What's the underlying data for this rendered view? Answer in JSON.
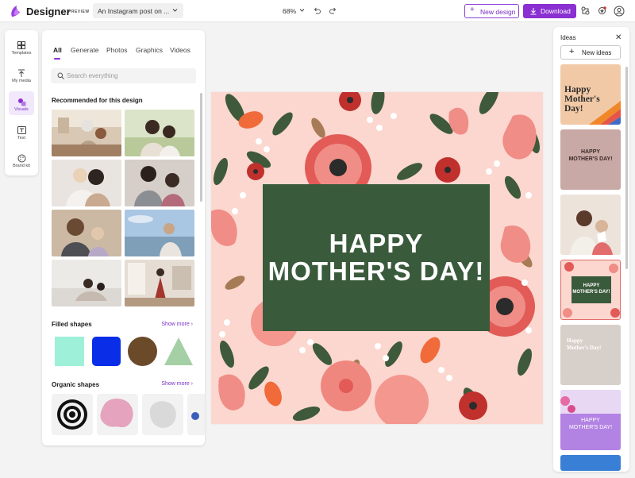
{
  "app": {
    "brand": "Designer",
    "preview_tag": "PREVIEW",
    "doc_title": "An Instagram post on ...",
    "zoom": "68%"
  },
  "toolbar": {
    "new_design": "New design",
    "download": "Download"
  },
  "rail": [
    {
      "label": "Templates",
      "icon": "templates-icon"
    },
    {
      "label": "My media",
      "icon": "upload-icon"
    },
    {
      "label": "Visuals",
      "icon": "visuals-icon",
      "active": true
    },
    {
      "label": "Text",
      "icon": "text-icon"
    },
    {
      "label": "Brand kit",
      "icon": "brand-kit-icon"
    }
  ],
  "panel": {
    "tabs": [
      "All",
      "Generate",
      "Photos",
      "Graphics",
      "Videos"
    ],
    "active_tab": "All",
    "search_placeholder": "Search everything",
    "recommended_title": "Recommended for this design",
    "filled_shapes_title": "Filled shapes",
    "organic_shapes_title": "Organic shapes",
    "show_more": "Show more",
    "shape_colors": [
      "#9ef0d8",
      "#0a2ee8",
      "#6b4a2a",
      "#a5cfa5"
    ]
  },
  "canvas": {
    "line1": "HAPPY",
    "line2": "MOTHER'S DAY!",
    "box_color": "#3a5a3c",
    "bg_color": "#fbd7cf"
  },
  "ideas": {
    "title": "Ideas",
    "new_ideas": "New ideas",
    "card1": "Happy Mother's Day!",
    "card2": "HAPPY MOTHER'S DAY!",
    "card4": "HAPPY MOTHER'S DAY!",
    "card5": "Happy Mother's Day!",
    "card6": "HAPPY MOTHER'S DAY!"
  }
}
